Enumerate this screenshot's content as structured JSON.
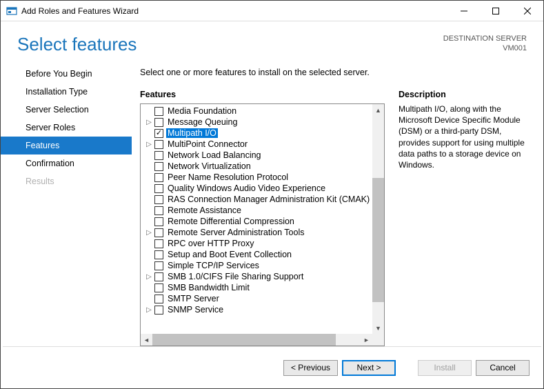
{
  "window": {
    "title": "Add Roles and Features Wizard"
  },
  "header": {
    "title": "Select features",
    "dest_label": "DESTINATION SERVER",
    "dest_value": "VM001"
  },
  "nav": {
    "items": [
      {
        "label": "Before You Begin",
        "state": "normal"
      },
      {
        "label": "Installation Type",
        "state": "normal"
      },
      {
        "label": "Server Selection",
        "state": "normal"
      },
      {
        "label": "Server Roles",
        "state": "normal"
      },
      {
        "label": "Features",
        "state": "active"
      },
      {
        "label": "Confirmation",
        "state": "normal"
      },
      {
        "label": "Results",
        "state": "disabled"
      }
    ]
  },
  "main": {
    "instruction": "Select one or more features to install on the selected server.",
    "features_title": "Features",
    "desc_title": "Description",
    "desc_text": "Multipath I/O, along with the Microsoft Device Specific Module (DSM) or a third-party DSM, provides support for using multiple data paths to a storage device on Windows."
  },
  "features": [
    {
      "label": "Media Foundation",
      "checked": false,
      "expandable": false,
      "selected": false
    },
    {
      "label": "Message Queuing",
      "checked": false,
      "expandable": true,
      "selected": false
    },
    {
      "label": "Multipath I/O",
      "checked": true,
      "expandable": false,
      "selected": true
    },
    {
      "label": "MultiPoint Connector",
      "checked": false,
      "expandable": true,
      "selected": false
    },
    {
      "label": "Network Load Balancing",
      "checked": false,
      "expandable": false,
      "selected": false
    },
    {
      "label": "Network Virtualization",
      "checked": false,
      "expandable": false,
      "selected": false
    },
    {
      "label": "Peer Name Resolution Protocol",
      "checked": false,
      "expandable": false,
      "selected": false
    },
    {
      "label": "Quality Windows Audio Video Experience",
      "checked": false,
      "expandable": false,
      "selected": false
    },
    {
      "label": "RAS Connection Manager Administration Kit (CMAK)",
      "checked": false,
      "expandable": false,
      "selected": false
    },
    {
      "label": "Remote Assistance",
      "checked": false,
      "expandable": false,
      "selected": false
    },
    {
      "label": "Remote Differential Compression",
      "checked": false,
      "expandable": false,
      "selected": false
    },
    {
      "label": "Remote Server Administration Tools",
      "checked": false,
      "expandable": true,
      "selected": false
    },
    {
      "label": "RPC over HTTP Proxy",
      "checked": false,
      "expandable": false,
      "selected": false
    },
    {
      "label": "Setup and Boot Event Collection",
      "checked": false,
      "expandable": false,
      "selected": false
    },
    {
      "label": "Simple TCP/IP Services",
      "checked": false,
      "expandable": false,
      "selected": false
    },
    {
      "label": "SMB 1.0/CIFS File Sharing Support",
      "checked": false,
      "expandable": true,
      "selected": false
    },
    {
      "label": "SMB Bandwidth Limit",
      "checked": false,
      "expandable": false,
      "selected": false
    },
    {
      "label": "SMTP Server",
      "checked": false,
      "expandable": false,
      "selected": false
    },
    {
      "label": "SNMP Service",
      "checked": false,
      "expandable": true,
      "selected": false
    }
  ],
  "footer": {
    "previous": "< Previous",
    "next": "Next >",
    "install": "Install",
    "cancel": "Cancel"
  }
}
